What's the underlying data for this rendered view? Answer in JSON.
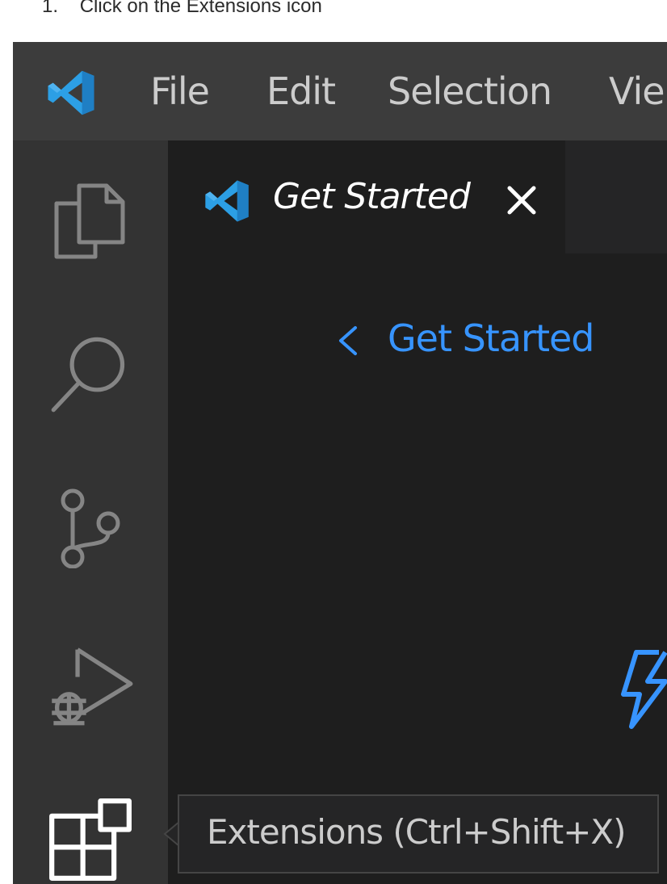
{
  "instruction": {
    "number": "1.",
    "text": "Click on the Extensions icon"
  },
  "menu": {
    "items": [
      "File",
      "Edit",
      "Selection",
      "Vie"
    ]
  },
  "activity_bar": {
    "icons": [
      "explorer-icon",
      "search-icon",
      "source-control-icon",
      "run-debug-icon",
      "extensions-icon"
    ]
  },
  "editor": {
    "tab": {
      "label": "Get Started",
      "close_icon": "close-icon"
    },
    "back_link": "Get Started"
  },
  "tooltip": {
    "text": "Extensions (Ctrl+Shift+X)"
  },
  "colors": {
    "titlebar": "#3c3c3c",
    "activitybar": "#333333",
    "editor": "#1e1e1e",
    "accent": "#3794ff",
    "vscode_blue": "#2c9fe5"
  }
}
